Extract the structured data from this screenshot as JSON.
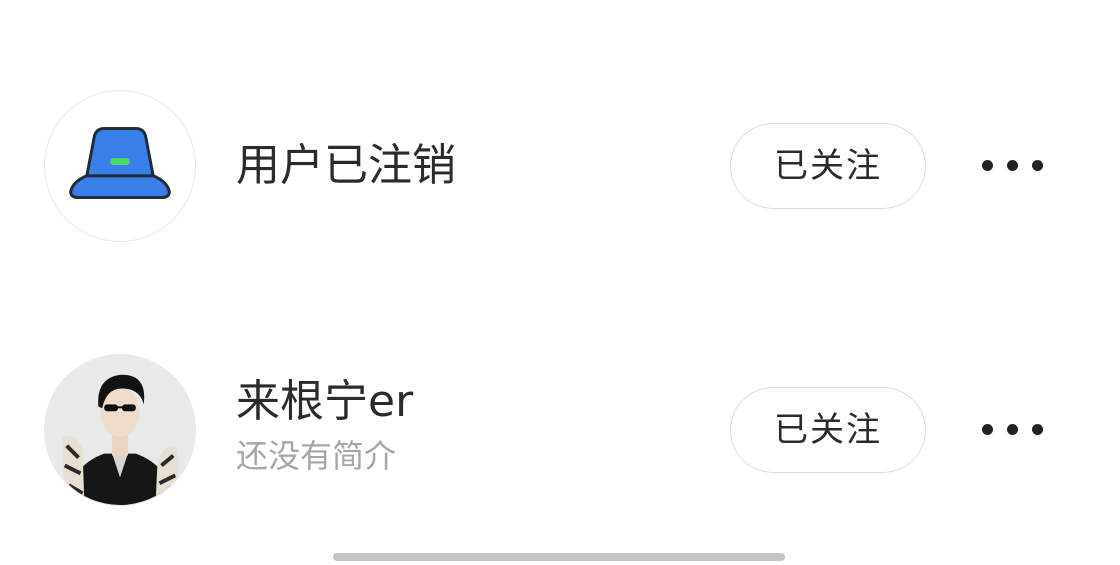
{
  "users": [
    {
      "name": "用户已注销",
      "bio": "",
      "follow_label": "已关注",
      "avatar_icon": "bucket-hat-icon"
    },
    {
      "name": "来根宁er",
      "bio": "还没有简介",
      "follow_label": "已关注",
      "avatar_icon": "user-photo"
    }
  ],
  "more_icon": "more-dots-icon",
  "colors": {
    "hat_blue": "#3a7fe8",
    "hat_band": "#4cd964",
    "text_primary": "#2b2b2b",
    "text_secondary": "#a6a6a6",
    "button_border": "#dcdcdc"
  }
}
